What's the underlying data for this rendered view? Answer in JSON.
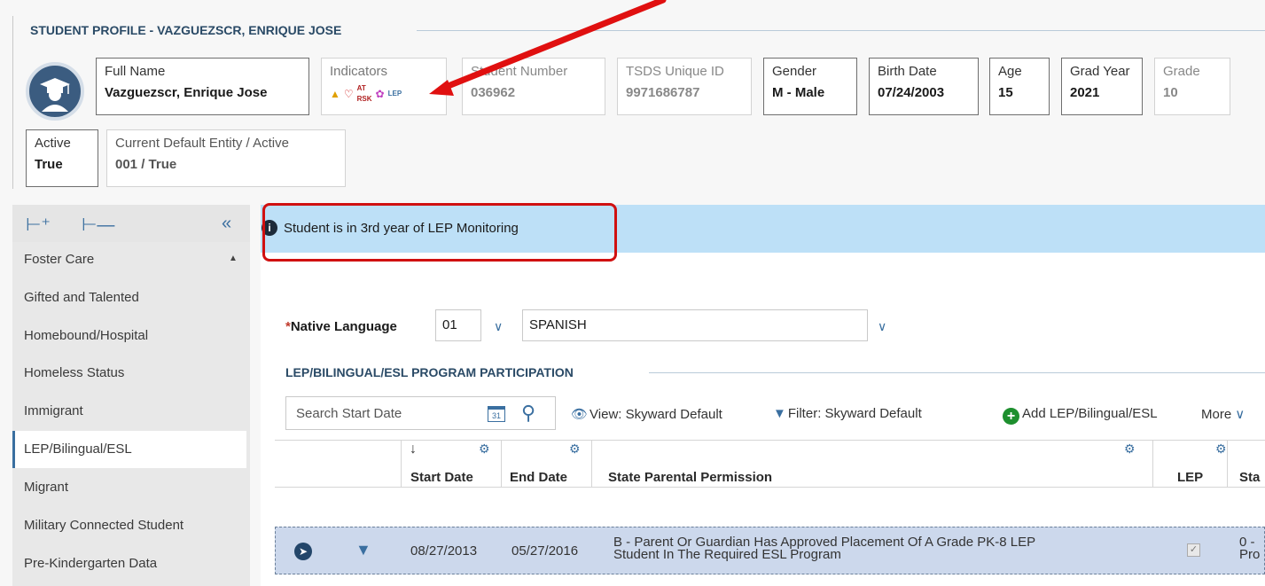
{
  "header": {
    "title": "STUDENT PROFILE - VAZGUEZSCR, ENRIQUE JOSE"
  },
  "fields": {
    "full_name": {
      "label": "Full Name",
      "value": "Vazguezscr, Enrique Jose"
    },
    "indicators": {
      "label": "Indicators",
      "icons": [
        "warning-icon",
        "heart-icon",
        "at-risk-icon",
        "flower-icon",
        "lep-icon"
      ]
    },
    "student_number": {
      "label": "Student Number",
      "value": "036962"
    },
    "tsds_id": {
      "label": "TSDS Unique ID",
      "value": "9971686787"
    },
    "gender": {
      "label": "Gender",
      "value": "M - Male"
    },
    "birth_date": {
      "label": "Birth Date",
      "value": "07/24/2003"
    },
    "age": {
      "label": "Age",
      "value": "15"
    },
    "grad_year": {
      "label": "Grad Year",
      "value": "2021"
    },
    "grade": {
      "label": "Grade",
      "value": "10"
    },
    "active": {
      "label": "Active",
      "value": "True"
    },
    "default_entity": {
      "label": "Current Default Entity / Active",
      "value": "001 / True"
    }
  },
  "sidebar": {
    "items": [
      {
        "label": "Foster Care"
      },
      {
        "label": "Gifted and Talented"
      },
      {
        "label": "Homebound/Hospital"
      },
      {
        "label": "Homeless Status"
      },
      {
        "label": "Immigrant"
      },
      {
        "label": "LEP/Bilingual/ESL"
      },
      {
        "label": "Migrant"
      },
      {
        "label": "Military Connected Student"
      },
      {
        "label": "Pre-Kindergarten Data"
      }
    ],
    "active_index": 5
  },
  "banner": {
    "text": "Student is in 3rd year of LEP Monitoring"
  },
  "native_language": {
    "label": "Native Language",
    "required_marker": "*",
    "code": "01",
    "name": "SPANISH"
  },
  "section": {
    "title": "LEP/BILINGUAL/ESL PROGRAM PARTICIPATION"
  },
  "toolbar": {
    "search_placeholder": "Search Start Date",
    "calendar_day": "31",
    "view_label": "View: Skyward Default",
    "filter_label": "Filter: Skyward Default",
    "add_label": "Add LEP/Bilingual/ESL",
    "more_label": "More"
  },
  "grid": {
    "columns": [
      "Start Date",
      "End Date",
      "State Parental Permission",
      "LEP",
      "Sta"
    ],
    "rows": [
      {
        "start_date": "08/27/2013",
        "end_date": "05/27/2016",
        "permission_line1": "B - Parent Or Guardian Has Approved Placement Of A Grade PK-8 LEP",
        "permission_line2": "Student In The Required ESL Program",
        "lep_checked": true,
        "status_line1": "0 -",
        "status_line2": "Pro"
      }
    ]
  },
  "colors": {
    "accent": "#3a6fa0",
    "banner_bg": "#bde0f7",
    "highlight": "#d01010",
    "row_bg": "#ccd8ec"
  }
}
